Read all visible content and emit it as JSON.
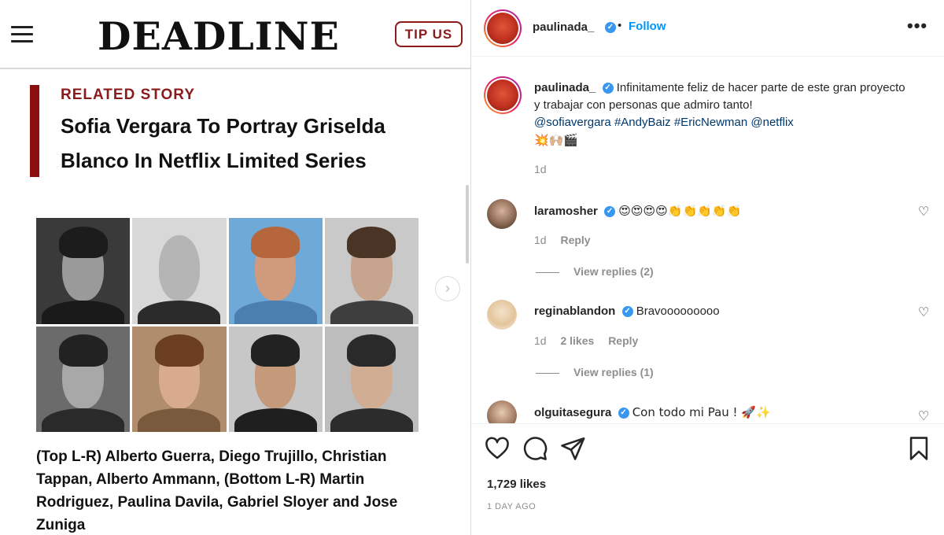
{
  "deadline": {
    "logo": "DEADLINE",
    "tip_us": "TIP US",
    "related_label": "RELATED STORY",
    "related_title": "Sofia Vergara To Portray Griselda Blanco In Netflix Limited Series",
    "caption": "(Top L-R) Alberto Guerra, Diego Trujillo, Christian Tappan, Alberto Ammann, (Bottom L-R) Martin Rodriguez, Paulina Davila, Gabriel Sloyer and Jose Zuniga",
    "next_arrow": "›"
  },
  "header": {
    "username": "paulinada_",
    "verified": "✓",
    "dot": "•",
    "follow": "Follow",
    "more": "•••"
  },
  "post": {
    "username": "paulinada_",
    "text": "Infinitamente feliz de hacer parte de este gran proyecto y trabajar con personas que admiro tanto!",
    "tag1": "@sofiavergara",
    "tag2": "#AndyBaiz",
    "tag3": "#EricNewman",
    "tag4": "@netflix",
    "emojis": "💥🙌🏼🎬",
    "time": "1d"
  },
  "comments": [
    {
      "username": "laramosher",
      "text": "😍😍😍😍👏👏👏👏👏",
      "time": "1d",
      "likes": "",
      "reply": "Reply",
      "view_replies": "View replies (2)"
    },
    {
      "username": "reginablandon",
      "text": "Bravooooooooo",
      "time": "1d",
      "likes": "2 likes",
      "reply": "Reply",
      "view_replies": "View replies (1)"
    },
    {
      "username": "olguitasegura",
      "text": "Con todo mi Pau ! 🚀✨"
    }
  ],
  "actions": {
    "likes": "1,729 likes",
    "date": "1 DAY AGO",
    "heart_glyph": "♡"
  },
  "colors": {
    "deadline_red": "#8b1a1a",
    "instagram_blue": "#0095f6",
    "tag_blue": "#00376b",
    "muted_gray": "#8e8e8e"
  }
}
